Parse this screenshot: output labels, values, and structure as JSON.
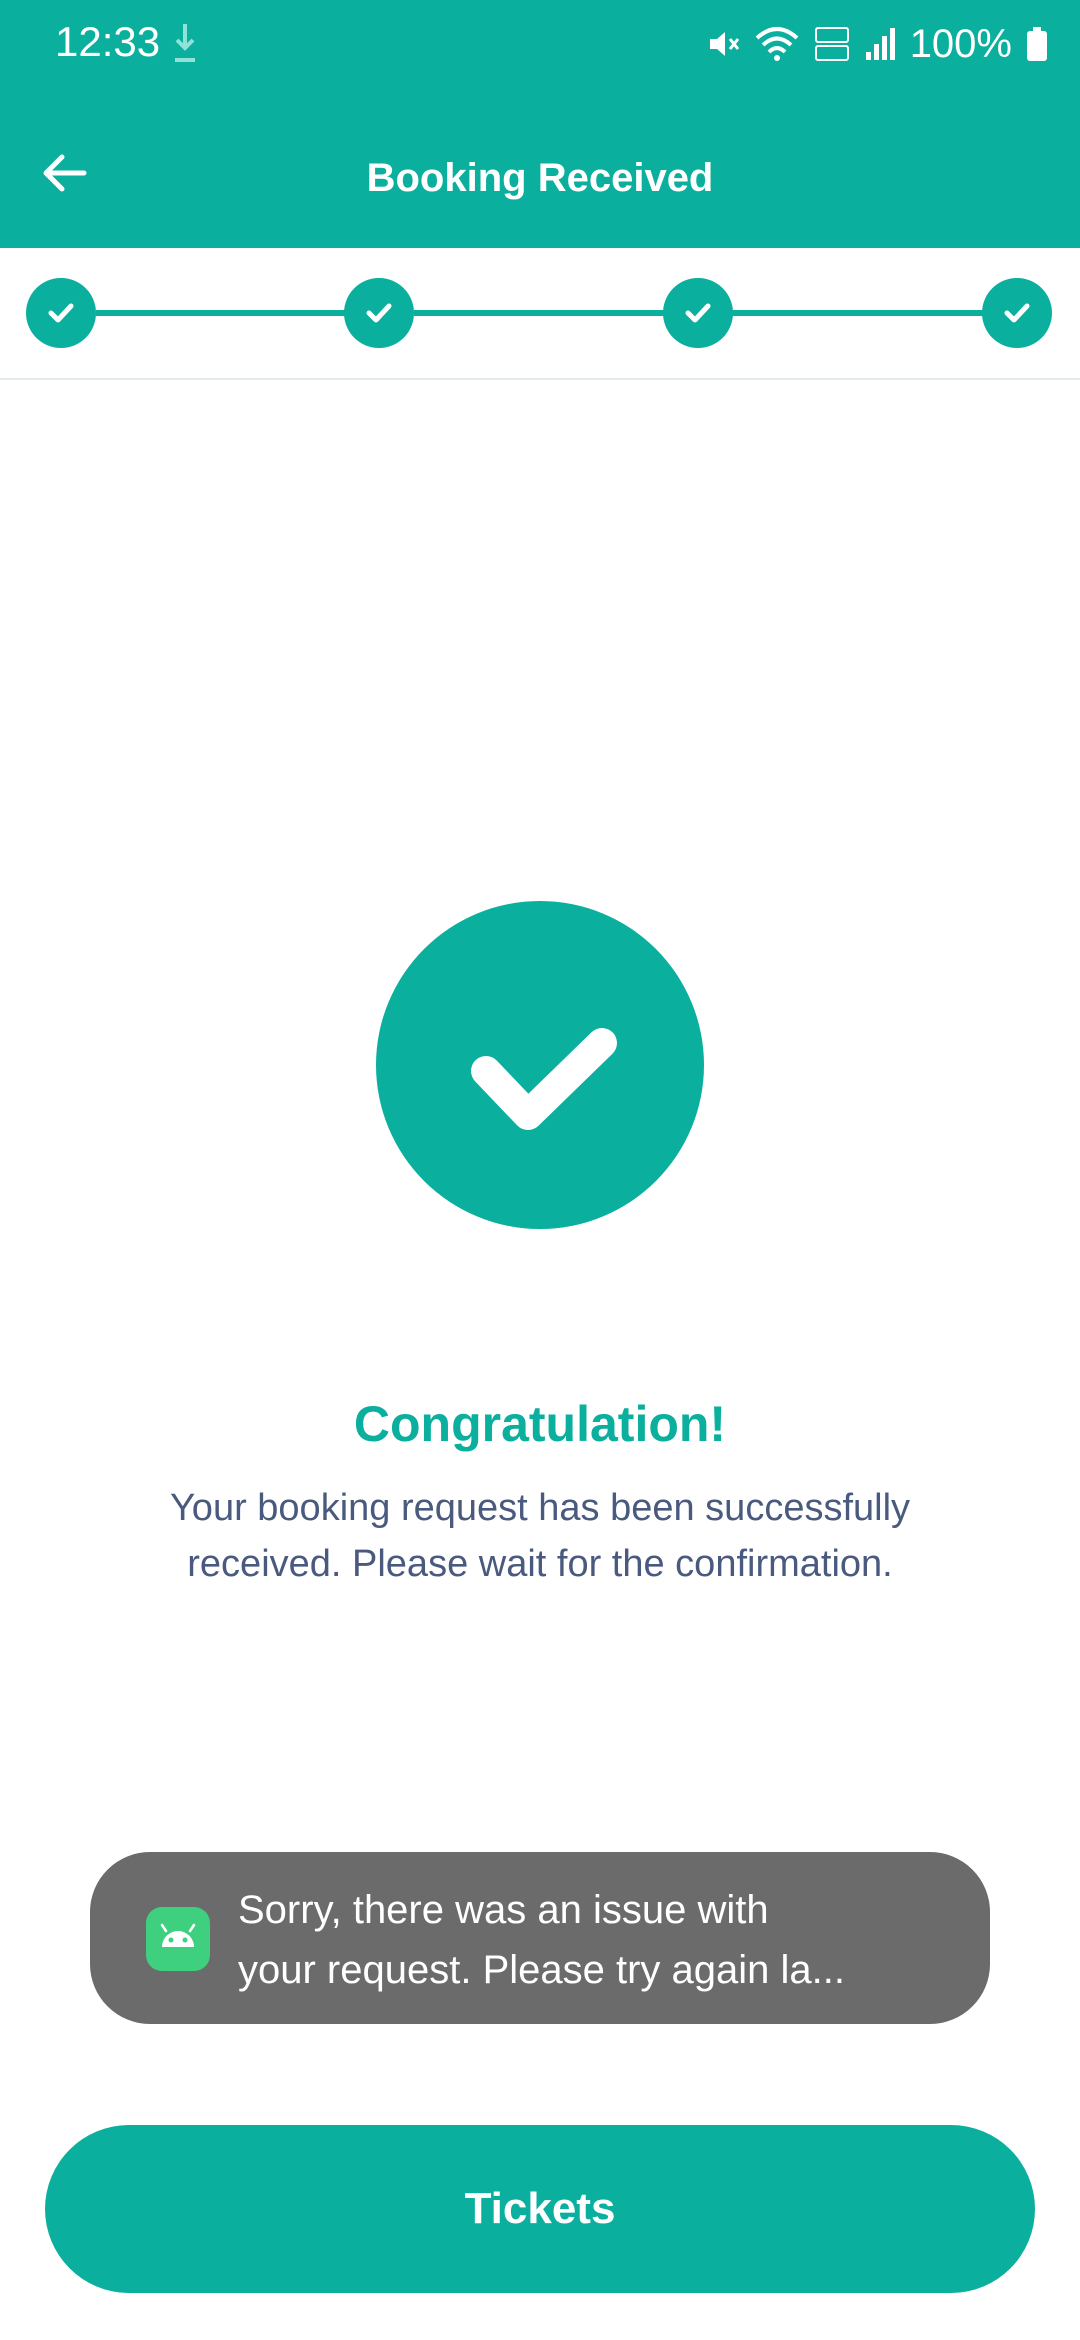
{
  "status_bar": {
    "time": "12:33",
    "battery": "100%"
  },
  "app_bar": {
    "title": "Booking Received"
  },
  "stepper": {
    "steps_completed": 4,
    "steps_total": 4
  },
  "success": {
    "heading": "Congratulation!",
    "message_line1": "Your booking request has been successfully",
    "message_line2": "received. Please wait for the confirmation."
  },
  "toast": {
    "line1": "Sorry, there was an issue with",
    "line2": "your request. Please try again la..."
  },
  "actions": {
    "tickets_label": "Tickets"
  },
  "colors": {
    "accent": "#0aaf9e",
    "text_muted": "#4a5a7e",
    "toast_bg": "#6b6b6c"
  }
}
